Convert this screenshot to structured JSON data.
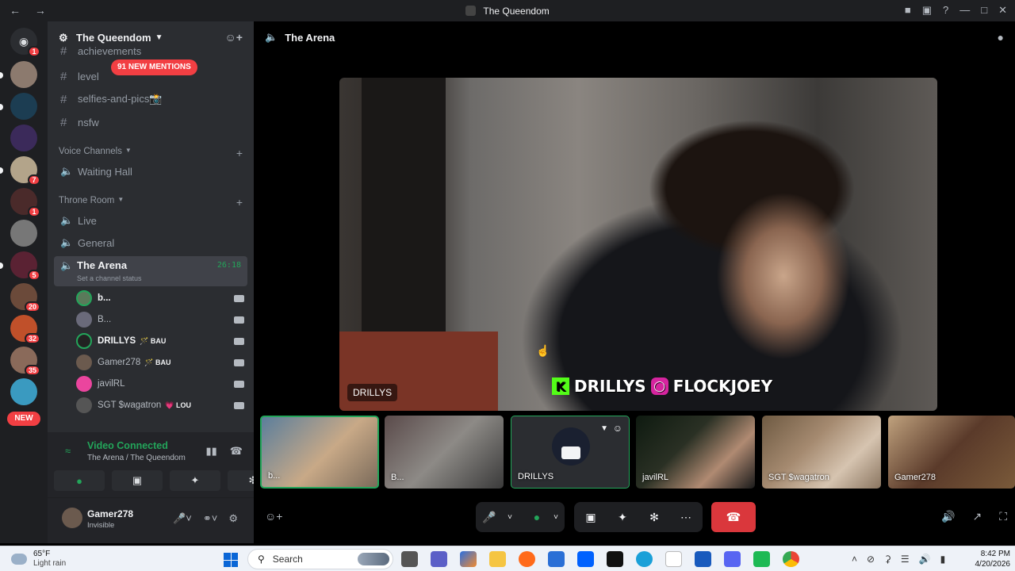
{
  "window": {
    "title": "The Queendom",
    "back_label": "←",
    "forward_label": "→"
  },
  "servers": {
    "home_badge": "1",
    "badges": [
      "1",
      "7",
      "1",
      "5",
      "20",
      "32",
      "35"
    ],
    "new_label": "NEW"
  },
  "server": {
    "name": "The Queendom"
  },
  "channels": {
    "mentions_pill": "91 NEW MENTIONS",
    "text": [
      {
        "name": "achievements"
      },
      {
        "name": "level"
      },
      {
        "name": "selfies-and-pics📸"
      },
      {
        "name": "nsfw"
      }
    ],
    "voice_category": "Voice Channels",
    "voice": [
      {
        "name": "Waiting Hall"
      }
    ],
    "throne_category": "Throne Room",
    "throne": [
      {
        "name": "Live"
      },
      {
        "name": "General"
      }
    ],
    "active": {
      "name": "The Arena",
      "timer": "26:18",
      "status": "Set a channel status"
    },
    "members": [
      {
        "name": "b...",
        "tag": ""
      },
      {
        "name": "B...",
        "tag": ""
      },
      {
        "name": "DRILLYS",
        "tag": "🪄 BAU"
      },
      {
        "name": "Gamer278",
        "tag": "🪄 BAU"
      },
      {
        "name": "javilRL",
        "tag": ""
      },
      {
        "name": "SGT $wagatron",
        "tag": "💗 LOU"
      }
    ]
  },
  "voice_panel": {
    "title": "Video Connected",
    "subtitle": "The Arena / The Queendom"
  },
  "user": {
    "name": "Gamer278",
    "status": "Invisible"
  },
  "main": {
    "channel_title": "The Arena",
    "stage_label": "DRILLYS",
    "overlay_name1": "DRILLYS",
    "overlay_name2": "FLOCKJOEY",
    "tiles": [
      {
        "label": "b..."
      },
      {
        "label": "B..."
      },
      {
        "label": "DRILLYS"
      },
      {
        "label": "javilRL"
      },
      {
        "label": "SGT $wagatron"
      },
      {
        "label": "Gamer278"
      }
    ]
  },
  "taskbar": {
    "weather_temp": "65°F",
    "weather_desc": "Light rain",
    "search_placeholder": "Search",
    "time": "8:42 PM",
    "date": "4/20/2026"
  },
  "colors": {
    "accent_green": "#23a55a",
    "danger_red": "#da373c",
    "badge_red": "#f23f43"
  }
}
